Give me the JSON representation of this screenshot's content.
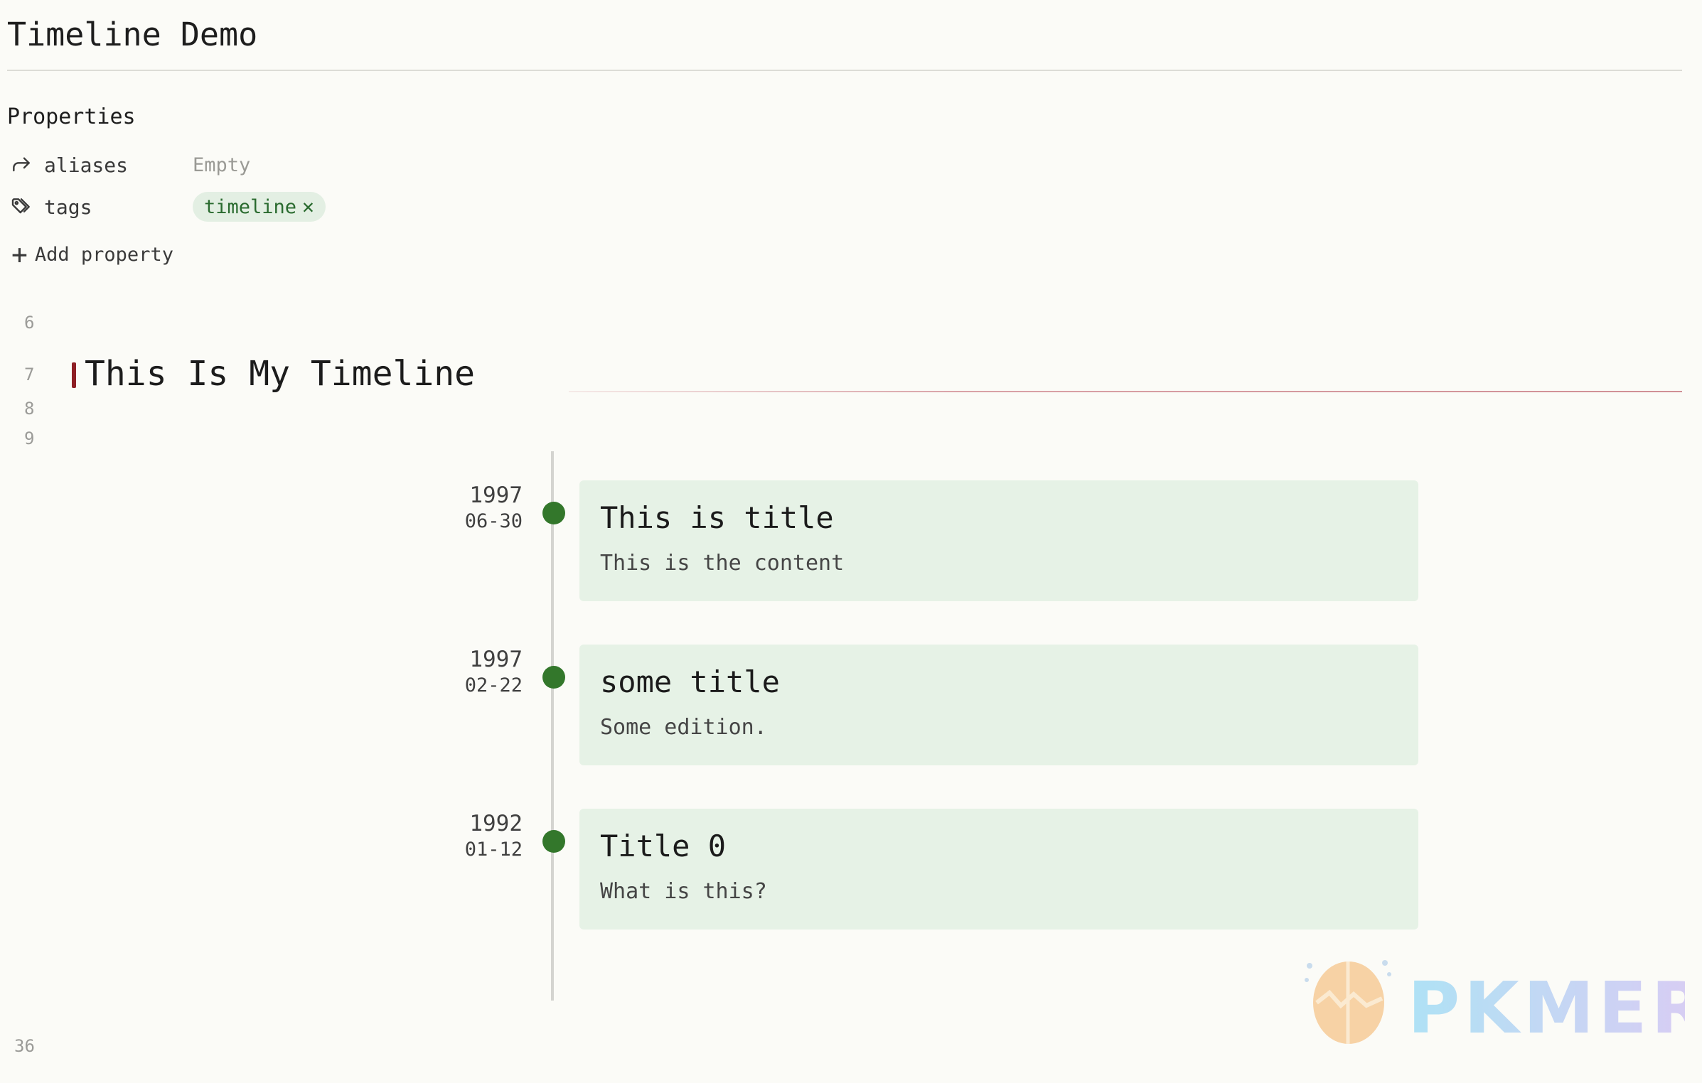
{
  "document": {
    "title": "Timeline Demo"
  },
  "properties": {
    "heading": "Properties",
    "items": [
      {
        "icon": "arrow-curve-right-icon",
        "key": "aliases",
        "value": "Empty"
      },
      {
        "icon": "tags-icon",
        "key": "tags",
        "tag": "timeline"
      }
    ],
    "add_label": "Add property"
  },
  "editor": {
    "line_numbers": {
      "l6": "6",
      "l7": "7",
      "l8": "8",
      "l9": "9",
      "l36": "36"
    },
    "heading": "This Is My Timeline"
  },
  "timeline": {
    "events": [
      {
        "year": "1997",
        "monthday": "06-30",
        "title": "This is title",
        "content": "This is the content"
      },
      {
        "year": "1997",
        "monthday": "02-22",
        "title": "some title",
        "content": "Some edition."
      },
      {
        "year": "1992",
        "monthday": "01-12",
        "title": "Title 0",
        "content": "What is this?"
      }
    ]
  },
  "watermark": {
    "text": "PKMER"
  },
  "colors": {
    "accent_green": "#33772b",
    "card_bg": "#e6f2e6",
    "tag_bg": "#e3efe3",
    "heading_marker": "#8e1f25"
  }
}
